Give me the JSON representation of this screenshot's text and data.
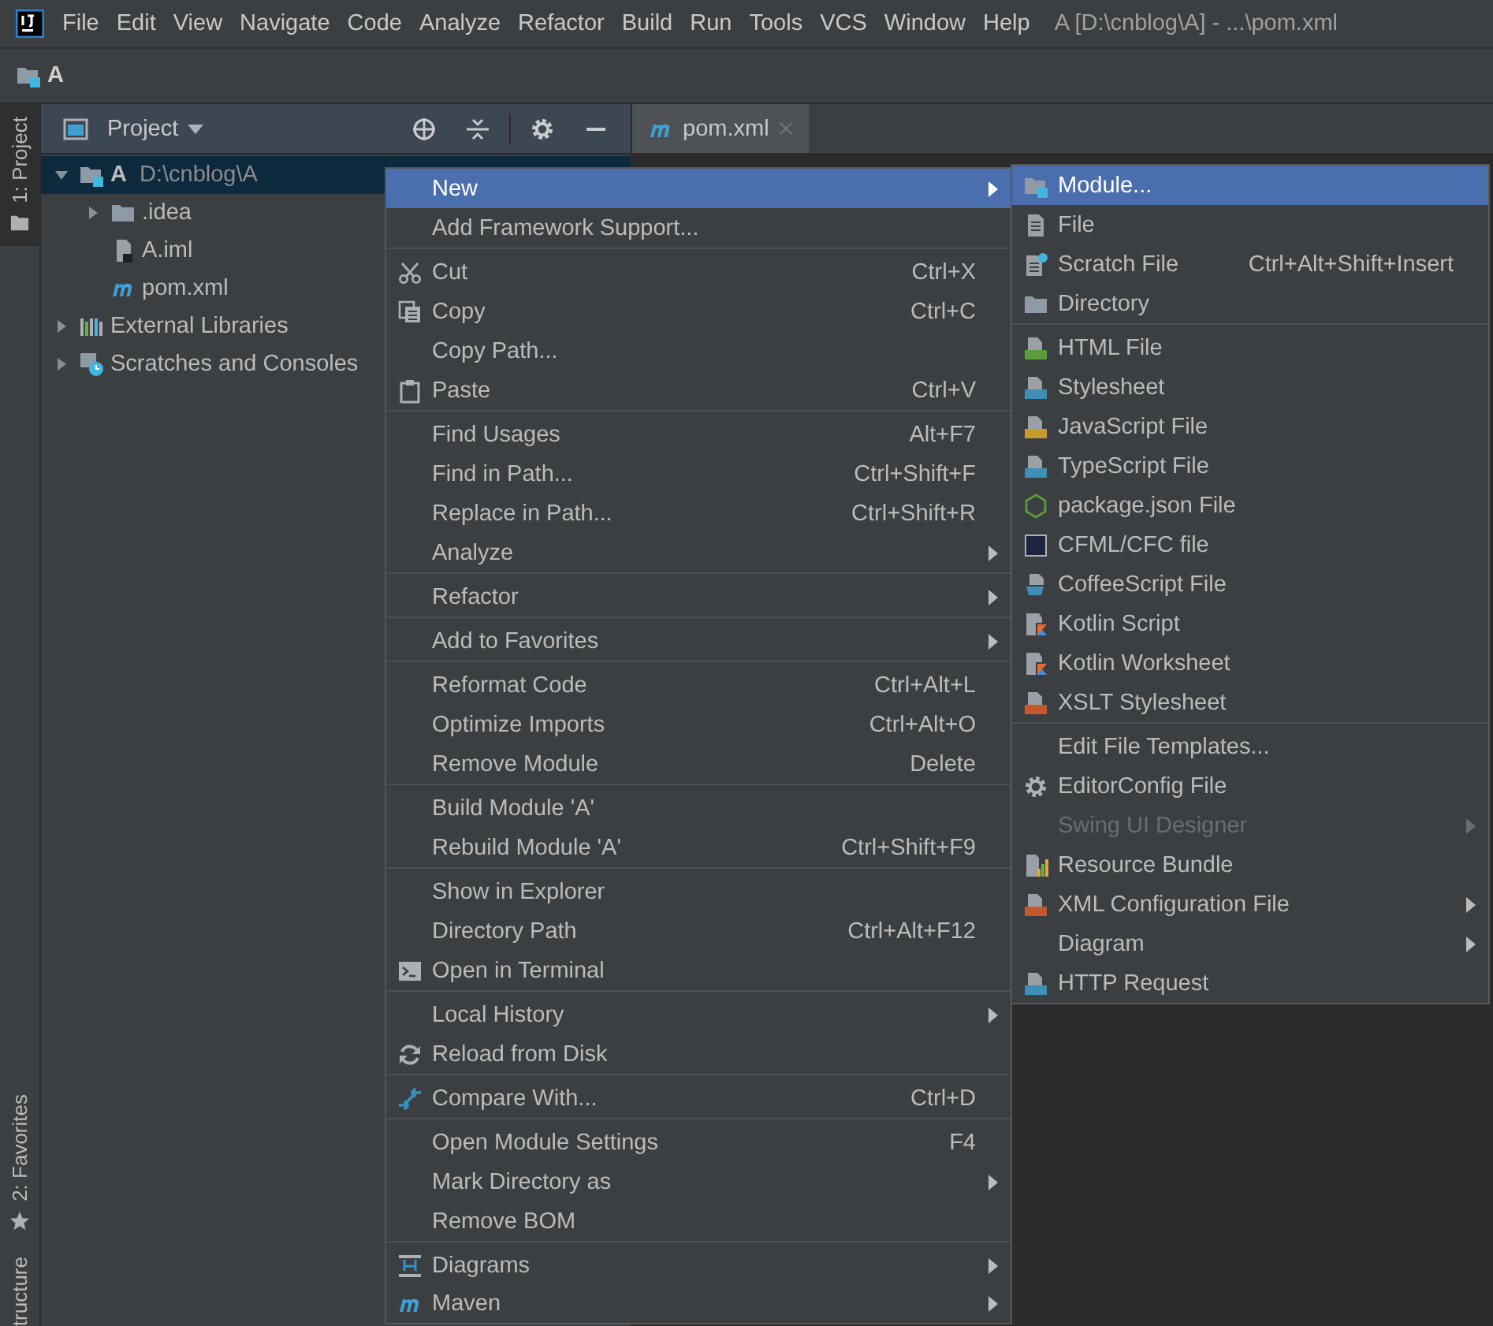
{
  "menubar": {
    "items": [
      "File",
      "Edit",
      "View",
      "Navigate",
      "Code",
      "Analyze",
      "Refactor",
      "Build",
      "Run",
      "Tools",
      "VCS",
      "Window",
      "Help"
    ],
    "title": "A [D:\\cnblog\\A] - ...\\pom.xml"
  },
  "navbar": {
    "crumb": "A"
  },
  "tool_stripe": {
    "top": [
      {
        "label": "1: Project",
        "selected": true
      }
    ],
    "bottom": [
      {
        "label": "2: Favorites",
        "selected": false
      },
      {
        "label": "tructure",
        "selected": false
      }
    ]
  },
  "project_panel": {
    "title": "Project",
    "tree": [
      {
        "label": "A",
        "path": "D:\\cnblog\\A",
        "expanded": true,
        "selected": true,
        "children": [
          {
            "label": ".idea",
            "expanded": false,
            "selected": false
          },
          {
            "label": "A.iml",
            "selected": false
          },
          {
            "label": "pom.xml",
            "selected": false
          }
        ]
      },
      {
        "label": "External Libraries",
        "expanded": false,
        "selected": false
      },
      {
        "label": "Scratches and Consoles",
        "expanded": false,
        "selected": false
      }
    ]
  },
  "editor_tabs": [
    {
      "label": "pom.xml",
      "selected": true
    }
  ],
  "context_menu": {
    "groups": [
      {
        "items": [
          {
            "label": "New",
            "submenu": true,
            "selected": true
          },
          {
            "label": "Add Framework Support...",
            "submenu": false,
            "selected": false
          }
        ]
      },
      {
        "items": [
          {
            "label": "Cut",
            "shortcut": "Ctrl+X",
            "submenu": false,
            "selected": false
          },
          {
            "label": "Copy",
            "shortcut": "Ctrl+C",
            "submenu": false,
            "selected": false
          },
          {
            "label": "Copy Path...",
            "submenu": false,
            "selected": false
          },
          {
            "label": "Paste",
            "shortcut": "Ctrl+V",
            "submenu": false,
            "selected": false
          }
        ]
      },
      {
        "items": [
          {
            "label": "Find Usages",
            "shortcut": "Alt+F7",
            "submenu": false,
            "selected": false
          },
          {
            "label": "Find in Path...",
            "shortcut": "Ctrl+Shift+F",
            "submenu": false,
            "selected": false
          },
          {
            "label": "Replace in Path...",
            "shortcut": "Ctrl+Shift+R",
            "submenu": false,
            "selected": false
          },
          {
            "label": "Analyze",
            "submenu": true,
            "selected": false
          }
        ]
      },
      {
        "items": [
          {
            "label": "Refactor",
            "submenu": true,
            "selected": false
          }
        ]
      },
      {
        "items": [
          {
            "label": "Add to Favorites",
            "submenu": true,
            "selected": false
          }
        ]
      },
      {
        "items": [
          {
            "label": "Reformat Code",
            "shortcut": "Ctrl+Alt+L",
            "submenu": false,
            "selected": false
          },
          {
            "label": "Optimize Imports",
            "shortcut": "Ctrl+Alt+O",
            "submenu": false,
            "selected": false
          },
          {
            "label": "Remove Module",
            "shortcut": "Delete",
            "submenu": false,
            "selected": false
          }
        ]
      },
      {
        "items": [
          {
            "label": "Build Module 'A'",
            "submenu": false,
            "selected": false
          },
          {
            "label": "Rebuild Module 'A'",
            "shortcut": "Ctrl+Shift+F9",
            "submenu": false,
            "selected": false
          }
        ]
      },
      {
        "items": [
          {
            "label": "Show in Explorer",
            "submenu": false,
            "selected": false
          },
          {
            "label": "Directory Path",
            "shortcut": "Ctrl+Alt+F12",
            "submenu": false,
            "selected": false
          },
          {
            "label": "Open in Terminal",
            "submenu": false,
            "selected": false
          }
        ]
      },
      {
        "items": [
          {
            "label": "Local History",
            "submenu": true,
            "selected": false
          },
          {
            "label": "Reload from Disk",
            "submenu": false,
            "selected": false
          }
        ]
      },
      {
        "items": [
          {
            "label": "Compare With...",
            "shortcut": "Ctrl+D",
            "submenu": false,
            "selected": false
          }
        ]
      },
      {
        "items": [
          {
            "label": "Open Module Settings",
            "shortcut": "F4",
            "submenu": false,
            "selected": false
          },
          {
            "label": "Mark Directory as",
            "submenu": true,
            "selected": false
          },
          {
            "label": "Remove BOM",
            "submenu": false,
            "selected": false
          }
        ]
      },
      {
        "items": [
          {
            "label": "Diagrams",
            "submenu": true,
            "selected": false
          },
          {
            "label": "Maven",
            "submenu": true,
            "selected": false
          }
        ]
      }
    ]
  },
  "new_submenu": {
    "groups": [
      {
        "items": [
          {
            "label": "Module...",
            "submenu": false,
            "selected": true,
            "disabled": false
          },
          {
            "label": "File",
            "submenu": false,
            "selected": false,
            "disabled": false
          },
          {
            "label": "Scratch File",
            "shortcut": "Ctrl+Alt+Shift+Insert",
            "submenu": false,
            "selected": false,
            "disabled": false
          },
          {
            "label": "Directory",
            "submenu": false,
            "selected": false,
            "disabled": false
          }
        ]
      },
      {
        "items": [
          {
            "label": "HTML File",
            "submenu": false,
            "selected": false,
            "disabled": false
          },
          {
            "label": "Stylesheet",
            "submenu": false,
            "selected": false,
            "disabled": false
          },
          {
            "label": "JavaScript File",
            "submenu": false,
            "selected": false,
            "disabled": false
          },
          {
            "label": "TypeScript File",
            "submenu": false,
            "selected": false,
            "disabled": false
          },
          {
            "label": "package.json File",
            "submenu": false,
            "selected": false,
            "disabled": false
          },
          {
            "label": "CFML/CFC file",
            "submenu": false,
            "selected": false,
            "disabled": false
          },
          {
            "label": "CoffeeScript File",
            "submenu": false,
            "selected": false,
            "disabled": false
          },
          {
            "label": "Kotlin Script",
            "submenu": false,
            "selected": false,
            "disabled": false
          },
          {
            "label": "Kotlin Worksheet",
            "submenu": false,
            "selected": false,
            "disabled": false
          },
          {
            "label": "XSLT Stylesheet",
            "submenu": false,
            "selected": false,
            "disabled": false
          }
        ]
      },
      {
        "items": [
          {
            "label": "Edit File Templates...",
            "submenu": false,
            "selected": false,
            "disabled": false
          },
          {
            "label": "EditorConfig File",
            "submenu": false,
            "selected": false,
            "disabled": false
          },
          {
            "label": "Swing UI Designer",
            "submenu": true,
            "selected": false,
            "disabled": true
          },
          {
            "label": "Resource Bundle",
            "submenu": false,
            "selected": false,
            "disabled": false
          },
          {
            "label": "XML Configuration File",
            "submenu": true,
            "selected": false,
            "disabled": false
          },
          {
            "label": "Diagram",
            "submenu": true,
            "selected": false,
            "disabled": false
          },
          {
            "label": "HTTP Request",
            "submenu": false,
            "selected": false,
            "disabled": false
          }
        ]
      }
    ]
  }
}
